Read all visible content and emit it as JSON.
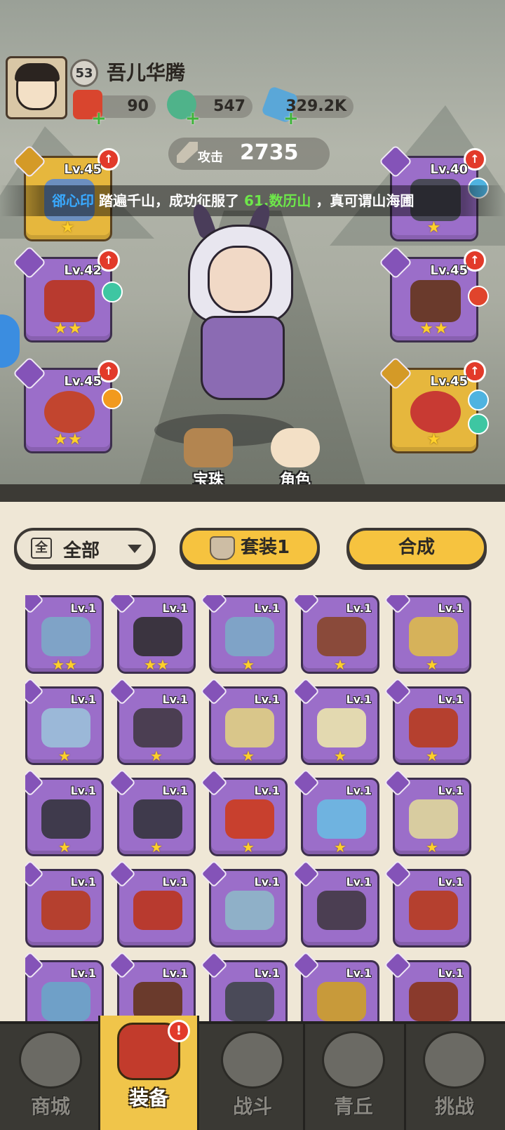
{
  "player": {
    "level": "53",
    "name": "吾儿华腾",
    "resources": [
      {
        "icon": "red-envelope-icon",
        "value": "90"
      },
      {
        "icon": "jade-dragon-icon",
        "value": "547"
      },
      {
        "icon": "crystal-icon",
        "value": "329.2K"
      }
    ],
    "attack_label": "攻击",
    "attack_value": "2735"
  },
  "marquee": {
    "name": "郤心印",
    "text1": "踏遍千山，成功征服了",
    "place": "61.数历山",
    "text2": "，真可谓山海圃"
  },
  "equipped": {
    "left": [
      {
        "level": "Lv.45",
        "stars": "★",
        "rarity": "gold",
        "type": "sword-icon",
        "art": "bow"
      },
      {
        "level": "Lv.42",
        "stars": "★★",
        "rarity": "purple",
        "type": "armor-icon",
        "art": "helmet"
      },
      {
        "level": "Lv.45",
        "stars": "★★",
        "rarity": "purple",
        "type": "ring-icon",
        "art": "flower-bow"
      }
    ],
    "right": [
      {
        "level": "Lv.40",
        "stars": "★",
        "rarity": "purple",
        "type": "belt-icon",
        "art": "belt"
      },
      {
        "level": "Lv.45",
        "stars": "★★",
        "rarity": "purple",
        "type": "boot-icon",
        "art": "boots"
      },
      {
        "level": "Lv.45",
        "stars": "★",
        "rarity": "gold",
        "type": "amulet-icon",
        "art": "lotus"
      }
    ]
  },
  "mid_buttons": {
    "gems_label": "宝珠",
    "role_label": "角色"
  },
  "filter": {
    "box": "全",
    "label": "全部"
  },
  "buttons": {
    "set_label": "套装1",
    "craft_label": "合成"
  },
  "inventory": [
    {
      "level": "Lv.1",
      "stars": "★★"
    },
    {
      "level": "Lv.1",
      "stars": "★★"
    },
    {
      "level": "Lv.1",
      "stars": "★"
    },
    {
      "level": "Lv.1",
      "stars": "★"
    },
    {
      "level": "Lv.1",
      "stars": "★"
    },
    {
      "level": "Lv.1",
      "stars": "★"
    },
    {
      "level": "Lv.1",
      "stars": "★"
    },
    {
      "level": "Lv.1",
      "stars": "★"
    },
    {
      "level": "Lv.1",
      "stars": "★"
    },
    {
      "level": "Lv.1",
      "stars": "★"
    },
    {
      "level": "Lv.1",
      "stars": "★"
    },
    {
      "level": "Lv.1",
      "stars": "★"
    },
    {
      "level": "Lv.1",
      "stars": "★"
    },
    {
      "level": "Lv.1",
      "stars": "★"
    },
    {
      "level": "Lv.1",
      "stars": "★"
    },
    {
      "level": "Lv.1",
      "stars": ""
    },
    {
      "level": "Lv.1",
      "stars": ""
    },
    {
      "level": "Lv.1",
      "stars": ""
    },
    {
      "level": "Lv.1",
      "stars": ""
    },
    {
      "level": "Lv.1",
      "stars": ""
    },
    {
      "level": "Lv.1",
      "stars": ""
    },
    {
      "level": "Lv.1",
      "stars": ""
    },
    {
      "level": "Lv.1",
      "stars": ""
    },
    {
      "level": "Lv.1",
      "stars": ""
    },
    {
      "level": "Lv.1",
      "stars": ""
    }
  ],
  "nav": [
    {
      "label": "商城",
      "icon": "shop-icon",
      "active": false
    },
    {
      "label": "装备",
      "icon": "equipment-icon",
      "active": true,
      "badge": "!"
    },
    {
      "label": "战斗",
      "icon": "battle-icon",
      "active": false
    },
    {
      "label": "青丘",
      "icon": "mountain-icon",
      "active": false
    },
    {
      "label": "挑战",
      "icon": "challenge-icon",
      "active": false
    }
  ],
  "colors": {
    "slot_purple": "#9b6ec9",
    "slot_gold": "#e6b73d",
    "accent_yellow": "#f6c33f",
    "marquee_name": "#39a9ff",
    "marquee_place": "#6ee84a",
    "upgrade_red": "#e23a2a"
  }
}
